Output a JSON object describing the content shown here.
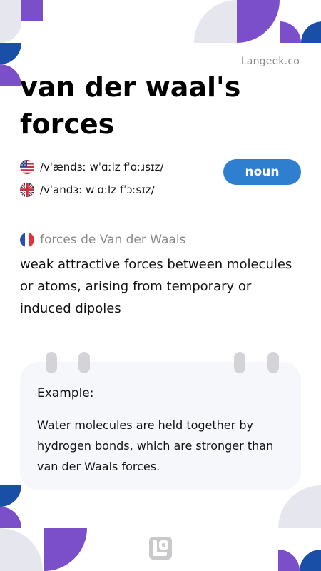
{
  "brand": "Langeek.co",
  "word": "van der waal's forces",
  "part_of_speech": "noun",
  "pronunciations": {
    "us": "/vˈændɜː wˈɑːlz fˈoːɹsɪz/",
    "uk": "/vˈandɜː wˈɑːlz fˈɔːsɪz/"
  },
  "translation": {
    "language_flag": "french-flag-icon",
    "text": "forces de Van der Waals"
  },
  "definition": "weak attractive forces between molecules or atoms, arising from temporary or induced dipoles",
  "example": {
    "label": "Example:",
    "text": "Water molecules are held together by hydrogen bonds, which are stronger than van der Waals forces."
  },
  "colors": {
    "accent_blue": "#2f7fd1",
    "purple": "#7b4fc9",
    "navy": "#1a4fa8",
    "light_gray": "#e6e7ee",
    "card_bg": "#f6f7fb"
  }
}
